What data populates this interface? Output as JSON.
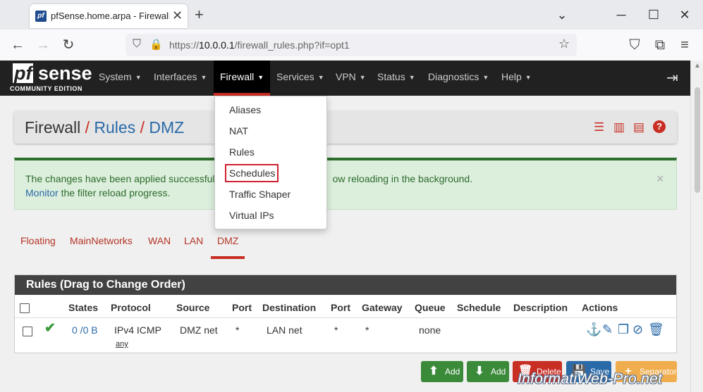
{
  "browser": {
    "tab_title": "pfSense.home.arpa - Firewall: Rules",
    "favicon": "pf",
    "url_prefix": "https://",
    "url_host": "10.0.0.1",
    "url_path": "/firewall_rules.php?if=opt1"
  },
  "navbar": {
    "logo_pf": "pf",
    "logo_sense": "sense",
    "logo_edition": "COMMUNITY EDITION",
    "menus": [
      "System",
      "Interfaces",
      "Firewall",
      "Services",
      "VPN",
      "Status",
      "Diagnostics",
      "Help"
    ],
    "active_menu": "Firewall"
  },
  "breadcrumb": {
    "root": "Firewall",
    "sep": "/",
    "level2": "Rules",
    "level3": "DMZ"
  },
  "alert": {
    "line1_start": "The changes have been applied successfull",
    "line1_end": "ow reloading in the background.",
    "link": "Monitor",
    "line2_rest": " the filter reload progress.",
    "close": "×"
  },
  "subtabs": [
    "Floating",
    "MainNetworks",
    "WAN",
    "LAN",
    "DMZ"
  ],
  "active_subtab": "DMZ",
  "rules_table": {
    "title": "Rules (Drag to Change Order)",
    "headers": [
      "States",
      "Protocol",
      "Source",
      "Port",
      "Destination",
      "Port",
      "Gateway",
      "Queue",
      "Schedule",
      "Description",
      "Actions"
    ],
    "rows": [
      {
        "states": "0 /0 B",
        "protocol": "IPv4 ICMP",
        "protocol_sub": "any",
        "source": "DMZ net",
        "source_port": "*",
        "destination": "LAN net",
        "dest_port": "*",
        "gateway": "*",
        "queue": "none",
        "schedule": "",
        "description": ""
      }
    ]
  },
  "buttons": {
    "add_top": "Add",
    "add_bottom": "Add",
    "delete": "Delete",
    "save": "Save",
    "separator": "Separator"
  },
  "dropdown": {
    "items": [
      "Aliases",
      "NAT",
      "Rules",
      "Schedules",
      "Traffic Shaper",
      "Virtual IPs"
    ],
    "highlighted": "Schedules"
  },
  "watermark": "InformatiWeb-Pro.net",
  "colors": {
    "navbar": "#212121",
    "accent_red": "#c82e24",
    "link_blue": "#2a6aa8",
    "success_green": "#2e6e2e",
    "btn_green": "#3a8a3a",
    "btn_red": "#c82e24",
    "btn_blue": "#2a6aa8",
    "btn_orange": "#f0ad4e"
  }
}
